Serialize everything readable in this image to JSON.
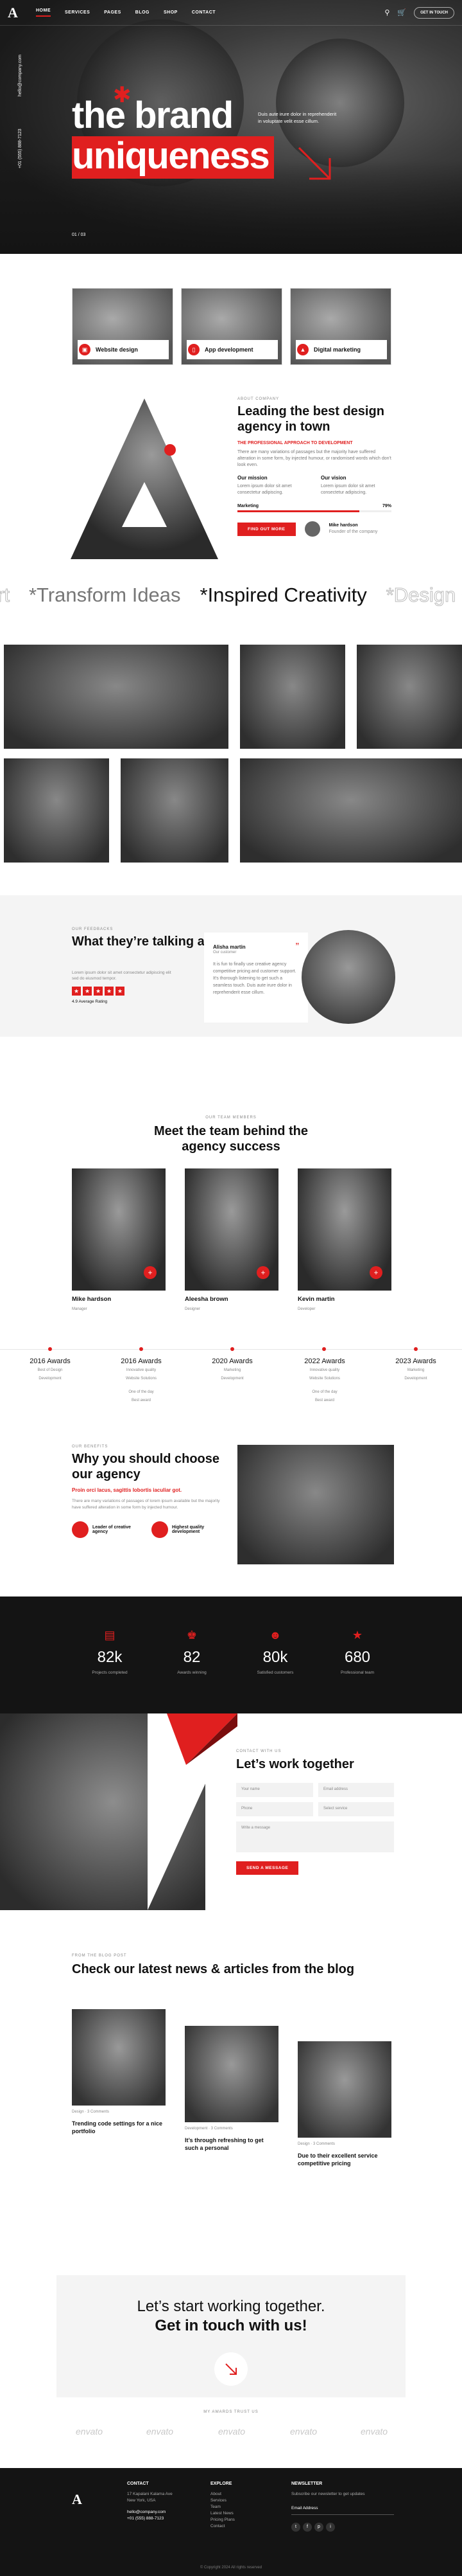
{
  "nav": {
    "items": [
      "HOME",
      "SERVICES",
      "PAGES",
      "BLOG",
      "SHOP",
      "CONTACT"
    ],
    "cta": "GET IN TOUCH",
    "email_vertical": "hello@company.com",
    "phone_vertical": "+01 (555) 888-7123"
  },
  "hero": {
    "title1": "the brand",
    "title2": "uniqueness",
    "lede": "Duis aute irure dolor in reprehenderit in voluptate velit esse cillum.",
    "slide": "01 / 03"
  },
  "services": [
    {
      "label": "Website design",
      "icon": "monitor-icon"
    },
    {
      "label": "App development",
      "icon": "phone-icon"
    },
    {
      "label": "Digital marketing",
      "icon": "megaphone-icon"
    }
  ],
  "about": {
    "tag": "ABOUT COMPANY",
    "title": "Leading the best design agency in town",
    "sub": "THE PROFESSIONAL APPROACH TO DEVELOPMENT",
    "text": "There are many variations of passages but the majority have suffered alteration in some form, by injected humour, or randomised words which don't look even.",
    "mission_title": "Our mission",
    "mission_text": "Lorem ipsum dolor sit amet consectetur adipiscing.",
    "vision_title": "Our vision",
    "vision_text": "Lorem ipsum dolor sit amet consectetur adipiscing.",
    "skill": "Marketing",
    "skill_value": "79%",
    "button": "FIND OUT MORE",
    "person_name": "Mike hardson",
    "person_role": "Founder of the company"
  },
  "marquee": [
    "rt",
    "*Transform Ideas",
    "*Inspired Creativity",
    "*Design C"
  ],
  "testimonial": {
    "tag": "OUR FEEDBACKS",
    "title": "What they’re talking about us",
    "text": "Lorem ipsum dolor sit amet consectetur adipiscing elit sed do eiusmod tempor.",
    "rating": "4.9 Average Rating",
    "name": "Alisha martin",
    "role": "Our customer",
    "quote": "It is fun to finally use creative agency competitive pricing and customer support. It's thorough listening to get such a seamless touch. Duis aute irure dolor in reprehenderit esse cillum."
  },
  "team": {
    "tag": "OUR TEAM MEMBERS",
    "title": "Meet the team behind the agency success",
    "members": [
      {
        "name": "Mike hardson",
        "role": "Manager"
      },
      {
        "name": "Aleesha brown",
        "role": "Designer"
      },
      {
        "name": "Kevin martin",
        "role": "Developer"
      }
    ]
  },
  "timeline": [
    {
      "year": "2016 Awards",
      "lines": [
        "Best of Design",
        "Development"
      ]
    },
    {
      "year": "2016 Awards",
      "lines": [
        "Innovative quality",
        "Website Solutions",
        "",
        "One of the day",
        "Best award"
      ]
    },
    {
      "year": "2020 Awards",
      "lines": [
        "Marketing",
        "Development"
      ]
    },
    {
      "year": "2022 Awards",
      "lines": [
        "Innovative quality",
        "Website Solutions",
        "",
        "One of the day",
        "Best award"
      ]
    },
    {
      "year": "2023 Awards",
      "lines": [
        "Marketing",
        "Development"
      ]
    }
  ],
  "why": {
    "tag": "OUR BENEFITS",
    "title": "Why you should choose our agency",
    "sub": "Proin orci lacus, sagittis lobortis iaculiar got.",
    "text": "There are many variations of passages of lorem ipsum available but the majority have suffered alteration in some form by injected humour.",
    "f1": "Leader of creative agency",
    "f2": "Highest quality development"
  },
  "stats": [
    {
      "value": "82k",
      "label": "Projects completed",
      "icon": "project-icon"
    },
    {
      "value": "82",
      "label": "Awards winning",
      "icon": "trophy-icon"
    },
    {
      "value": "80k",
      "label": "Satisfied customers",
      "icon": "users-icon"
    },
    {
      "value": "680",
      "label": "Professional team",
      "icon": "team-icon"
    }
  ],
  "contact": {
    "tag": "CONTACT WITH US",
    "title": "Let’s work together",
    "fields": [
      "Your name",
      "Email address",
      "Phone",
      "Select service",
      "Write a message"
    ],
    "button": "SEND A MESSAGE"
  },
  "blog": {
    "tag": "FROM THE BLOG POST",
    "title": "Check our latest news & articles from the blog",
    "posts": [
      {
        "title": "Trending code settings for a nice portfolio",
        "meta": "Design · 3 Comments"
      },
      {
        "title": "It’s through refreshing to get such a personal",
        "meta": "Development · 3 Comments"
      },
      {
        "title": "Due to their excellent service competitive pricing",
        "meta": "Design · 3 Comments"
      }
    ]
  },
  "cta": {
    "line1": "Let’s start working together.",
    "line2": "Get in touch with us!",
    "partners_tag": "MY AWARDS TRUST US",
    "partners": [
      "envato",
      "envato",
      "envato",
      "envato",
      "envato"
    ]
  },
  "footer": {
    "contact_title": "CONTACT",
    "address": "17 Kapalani Kalama Ave",
    "city": "New York, USA",
    "email": "hello@company.com",
    "phone": "+01 (555) 888-7123",
    "explore_title": "EXPLORE",
    "links": [
      "About",
      "Services",
      "Team",
      "Latest News",
      "Pricing Plans",
      "Contact"
    ],
    "news_title": "NEWSLETTER",
    "news_text": "Subscribe our newsletter to get updates",
    "email_ph": "Email Address",
    "copyright": "© Copyright 2024 All rights reserved"
  }
}
